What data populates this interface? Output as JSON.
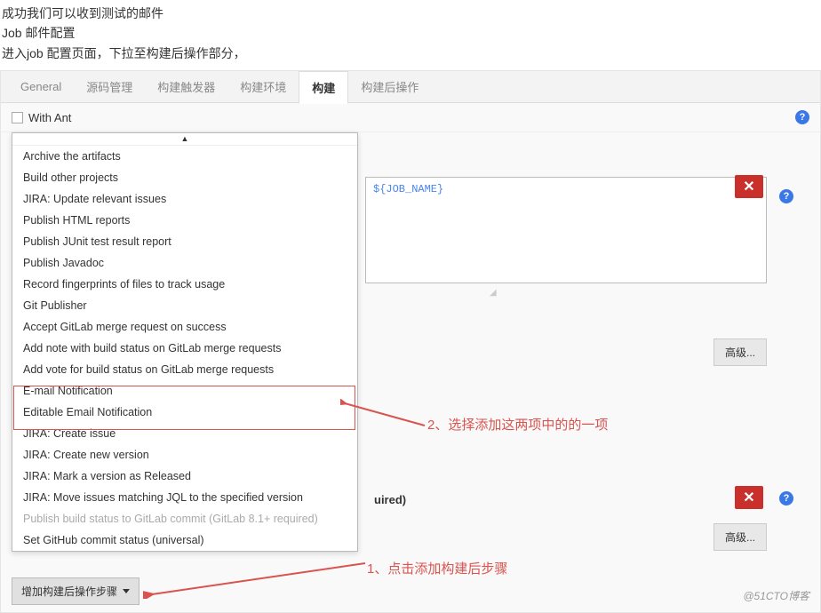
{
  "intro": {
    "line1": "成功我们可以收到测试的邮件",
    "line2": "Job 邮件配置",
    "line3": "进入job 配置页面，下拉至构建后操作部分，"
  },
  "tabs": [
    {
      "label": "General"
    },
    {
      "label": "源码管理"
    },
    {
      "label": "构建触发器"
    },
    {
      "label": "构建环境"
    },
    {
      "label": "构建",
      "active": true
    },
    {
      "label": "构建后操作"
    }
  ],
  "with_ant_label": "With Ant",
  "dropdown": {
    "items": [
      {
        "label": "Archive the artifacts"
      },
      {
        "label": "Build other projects"
      },
      {
        "label": "JIRA: Update relevant issues"
      },
      {
        "label": "Publish HTML reports"
      },
      {
        "label": "Publish JUnit test result report"
      },
      {
        "label": "Publish Javadoc"
      },
      {
        "label": "Record fingerprints of files to track usage"
      },
      {
        "label": "Git Publisher"
      },
      {
        "label": "Accept GitLab merge request on success"
      },
      {
        "label": "Add note with build status on GitLab merge requests"
      },
      {
        "label": "Add vote for build status on GitLab merge requests"
      },
      {
        "label": "E-mail Notification"
      },
      {
        "label": "Editable Email Notification"
      },
      {
        "label": "JIRA: Create issue"
      },
      {
        "label": "JIRA: Create new version"
      },
      {
        "label": "JIRA: Mark a version as Released"
      },
      {
        "label": "JIRA: Move issues matching JQL to the specified version"
      },
      {
        "label": "Publish build status to GitLab commit (GitLab 8.1+ required)",
        "disabled": true
      },
      {
        "label": "Set GitHub commit status (universal)"
      }
    ]
  },
  "textarea_value": "${JOB_NAME}",
  "required_text": "uired)",
  "advanced_btn": "高级...",
  "add_step_btn": "增加构建后操作步骤",
  "annotation1": "1、点击添加构建后步骤",
  "annotation2": "2、选择添加这两项中的的一项",
  "watermark": "@51CTO博客"
}
